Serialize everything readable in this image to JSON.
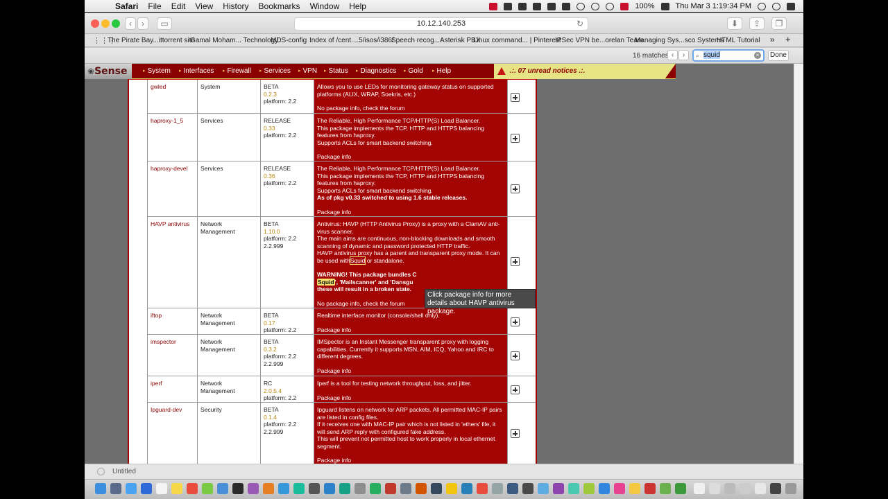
{
  "menubar": {
    "app": "Safari",
    "menus": [
      "File",
      "Edit",
      "View",
      "History",
      "Bookmarks",
      "Window",
      "Help"
    ],
    "battery": "100%",
    "clock": "Thu Mar 3  1:19:34 PM"
  },
  "browser": {
    "url": "10.12.140.253",
    "bookmarks": [
      "The Pirate Bay...ittorrent site",
      "Gamal Moham... Technology",
      "MDS-config",
      "Index of /cent....5/isos/i386/",
      "Speech recog...Asterisk PBX",
      "Linux command... | Pinterest",
      "IPSec VPN be...orelan Team",
      "Managing Sys...sco Systems",
      "HTML Tutorial"
    ],
    "find": {
      "count": "16 matches",
      "query": "squid",
      "done_label": "Done"
    },
    "status_text": "Untitled"
  },
  "pfsense": {
    "logo": "Sense",
    "nav": [
      "System",
      "Interfaces",
      "Firewall",
      "Services",
      "VPN",
      "Status",
      "Diagnostics",
      "Gold",
      "Help"
    ],
    "notices": ".:. 07 unread notices .:."
  },
  "packages": [
    {
      "name": "gwled",
      "category": "System",
      "status": "BETA",
      "version": "0.2.3",
      "platform": "platform: 2.2",
      "extra": "",
      "desc": [
        "Allows you to use LEDs for monitoring gateway status on supported platforms (ALIX, WRAP, Soekris, etc.)"
      ],
      "bold": "",
      "info": "No package info, check the forum"
    },
    {
      "name": "haproxy-1_5",
      "category": "Services",
      "status": "RELEASE",
      "version": "0.33",
      "platform": "platform: 2.2",
      "extra": "",
      "desc": [
        "The Reliable, High Performance TCP/HTTP(S) Load Balancer.",
        "This package implements the TCP, HTTP and HTTPS balancing features from haproxy.",
        "Supports ACLs for smart backend switching."
      ],
      "bold": "",
      "info": "Package info"
    },
    {
      "name": "haproxy-devel",
      "category": "Services",
      "status": "RELEASE",
      "version": "0.36",
      "platform": "platform: 2.2",
      "extra": "",
      "desc": [
        "The Reliable, High Performance TCP/HTTP(S) Load Balancer.",
        "This package implements the TCP, HTTP and HTTPS balancing features from haproxy.",
        "Supports ACLs for smart backend switching."
      ],
      "bold": "As of pkg v0.33 switched to using 1.6 stable releases.",
      "info": "Package info"
    },
    {
      "name": "HAVP antivirus",
      "category": "Network Management",
      "status": "BETA",
      "version": "1.10.0",
      "platform": "platform: 2.2",
      "extra": "2.2.999",
      "desc": [
        "Antivirus: HAVP (HTTP Antivirus Proxy) is a proxy with a ClamAV anti-virus scanner.",
        "The main aims are continuous, non-blocking downloads and smooth scanning of dynamic and password protected HTTP traffic.",
        "HAVP antivirus proxy has a parent and transparent proxy mode. It can be used with"
      ],
      "desc_match": "Squid",
      "desc_tail": " or standalone.",
      "warn_a": "WARNING! This package bundles C",
      "warn_match": "Squid",
      "warn_b": "', 'Mailscanner' and 'Dansgu",
      "warn_c": "these will result in a broken state.",
      "bold": "",
      "info": "No package info, check the forum"
    },
    {
      "name": "iftop",
      "category": "Network Management",
      "status": "BETA",
      "version": "0.17",
      "platform": "platform: 2.2",
      "extra": "",
      "desc": [
        "Realtime interface monitor (console/shell only)."
      ],
      "bold": "",
      "info": "Package info"
    },
    {
      "name": "imspector",
      "category": "Network Management",
      "status": "BETA",
      "version": "0.3.2",
      "platform": "platform: 2.2",
      "extra": "2.2.999",
      "desc": [
        "IMSpector is an Instant Messenger transparent proxy with logging capabilities. Currently it supports MSN, AIM, ICQ, Yahoo and IRC to different degrees."
      ],
      "bold": "",
      "info": "Package info"
    },
    {
      "name": "iperf",
      "category": "Network Management",
      "status": "RC",
      "version": "2.0.5.4",
      "platform": "platform: 2.2",
      "extra": "",
      "desc": [
        "Iperf is a tool for testing network throughput, loss, and jitter."
      ],
      "bold": "",
      "info": "Package info"
    },
    {
      "name": "Ipguard-dev",
      "category": "Security",
      "status": "BETA",
      "version": "0.1.4",
      "platform": "platform: 2.2",
      "extra": "2.2.999",
      "desc": [
        "Ipguard listens on network for ARP packets. All permitted MAC-IP pairs are listed in config files.",
        "If it receives one with MAC-IP pair which is not listed in 'ethers' file, it will send ARP reply with configured fake address.",
        "This will prevent not permitted host to work properly in local ethernet segment."
      ],
      "bold": "",
      "info": "Package info"
    }
  ],
  "tooltip": "Click package info for more details about HAVP antivirus package.",
  "colors": {
    "pf_red": "#8b0000",
    "desc_bg": "#a30505",
    "notice_bg": "#e6e485",
    "highlight": "#f4e26a"
  }
}
